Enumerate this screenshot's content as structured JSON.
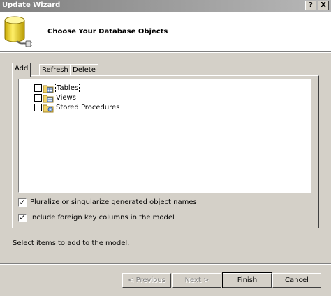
{
  "window": {
    "title": "Update Wizard",
    "help_glyph": "?",
    "close_glyph": "X"
  },
  "header": {
    "heading": "Choose Your Database Objects",
    "icon": "database-icon"
  },
  "tabs": [
    {
      "label": "Add",
      "active": true
    },
    {
      "label": "Refresh",
      "active": false
    },
    {
      "label": "Delete",
      "active": false
    }
  ],
  "tree": {
    "items": [
      {
        "label": "Tables",
        "checked": false,
        "icon": "folder-tables-icon",
        "focused": true
      },
      {
        "label": "Views",
        "checked": false,
        "icon": "folder-views-icon",
        "focused": false
      },
      {
        "label": "Stored Procedures",
        "checked": false,
        "icon": "folder-procedures-icon",
        "focused": false
      }
    ]
  },
  "options": {
    "pluralize": {
      "label": "Pluralize or singularize generated object names",
      "checked": true
    },
    "foreign_keys": {
      "label": "Include foreign key columns in the model",
      "checked": true
    }
  },
  "status": "Select items to add to the model.",
  "buttons": {
    "previous": "< Previous",
    "next": "Next >",
    "finish": "Finish",
    "cancel": "Cancel"
  },
  "colors": {
    "titlebar": "#808080",
    "face": "#d4d0c8",
    "highlight": "#ffffff",
    "shadow": "#808080"
  }
}
